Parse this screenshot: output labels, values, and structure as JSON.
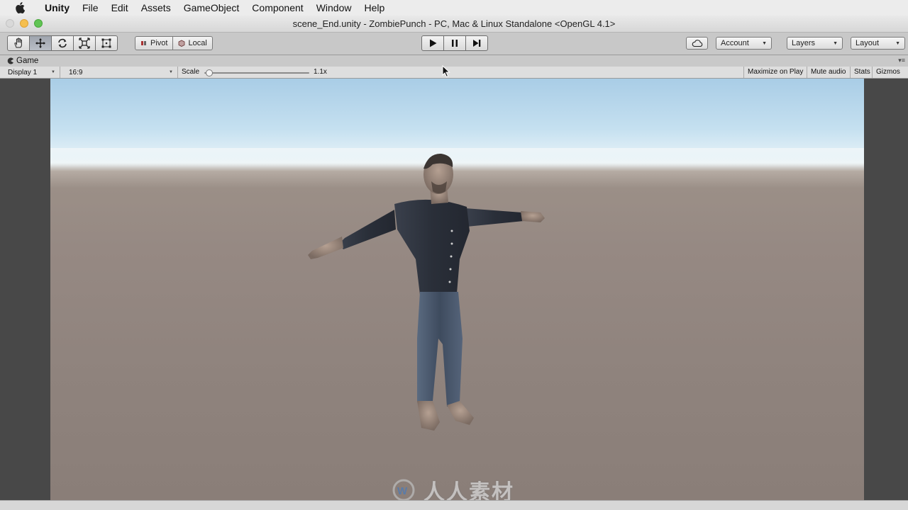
{
  "menubar": {
    "app_name": "Unity",
    "items": [
      "File",
      "Edit",
      "Assets",
      "GameObject",
      "Component",
      "Window",
      "Help"
    ]
  },
  "window": {
    "title": "scene_End.unity - ZombiePunch - PC, Mac & Linux Standalone <OpenGL 4.1>"
  },
  "toolbar": {
    "transform_tools": [
      "hand-icon",
      "move-icon",
      "rotate-icon",
      "scale-icon",
      "rect-icon"
    ],
    "active_tool": "move-icon",
    "pivot_label": "Pivot",
    "local_label": "Local",
    "play_controls": [
      "play-icon",
      "pause-icon",
      "step-icon"
    ],
    "account_label": "Account",
    "layers_label": "Layers",
    "layout_label": "Layout"
  },
  "game_tab": {
    "label": "Game"
  },
  "game_view": {
    "display": "Display 1",
    "aspect": "16:9",
    "scale_label": "Scale",
    "scale_value": "1.1x",
    "scale_fraction": 0.05,
    "maximize_label": "Maximize on Play",
    "mute_label": "Mute audio",
    "stats_label": "Stats",
    "gizmos_label": "Gizmos"
  },
  "watermark": {
    "text": "人人素材"
  },
  "colors": {
    "sky_top": "#a9cde6",
    "ground": "#8f837d",
    "shirt": "#2f3440",
    "jeans": "#4a5870",
    "skin": "#b8a396"
  }
}
